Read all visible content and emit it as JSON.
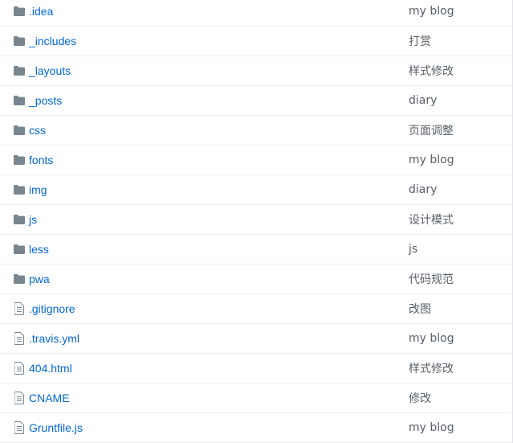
{
  "files": [
    {
      "name": ".idea",
      "type": "folder",
      "icon": "folder-icon",
      "message": "my blog"
    },
    {
      "name": "_includes",
      "type": "folder",
      "icon": "folder-icon",
      "message": "打赏"
    },
    {
      "name": "_layouts",
      "type": "folder",
      "icon": "folder-icon",
      "message": "样式修改"
    },
    {
      "name": "_posts",
      "type": "folder",
      "icon": "folder-icon",
      "message": "diary"
    },
    {
      "name": "css",
      "type": "folder",
      "icon": "folder-icon",
      "message": "页面调整"
    },
    {
      "name": "fonts",
      "type": "folder",
      "icon": "folder-icon",
      "message": "my blog"
    },
    {
      "name": "img",
      "type": "folder",
      "icon": "folder-icon",
      "message": "diary"
    },
    {
      "name": "js",
      "type": "folder",
      "icon": "folder-icon",
      "message": "设计模式"
    },
    {
      "name": "less",
      "type": "folder",
      "icon": "folder-icon",
      "message": "js"
    },
    {
      "name": "pwa",
      "type": "folder",
      "icon": "folder-icon",
      "message": "代码规范"
    },
    {
      "name": ".gitignore",
      "type": "file",
      "icon": "file-icon",
      "message": "改图"
    },
    {
      "name": ".travis.yml",
      "type": "file",
      "icon": "file-icon",
      "message": "my blog"
    },
    {
      "name": "404.html",
      "type": "file",
      "icon": "file-icon",
      "message": "样式修改"
    },
    {
      "name": "CNAME",
      "type": "file",
      "icon": "file-icon",
      "message": "修改"
    },
    {
      "name": "Gruntfile.js",
      "type": "file",
      "icon": "file-icon",
      "message": "my blog"
    }
  ],
  "colors": {
    "link": "#0366d6",
    "message": "#586069",
    "icon": "#79858f",
    "divider": "#eaecef"
  }
}
